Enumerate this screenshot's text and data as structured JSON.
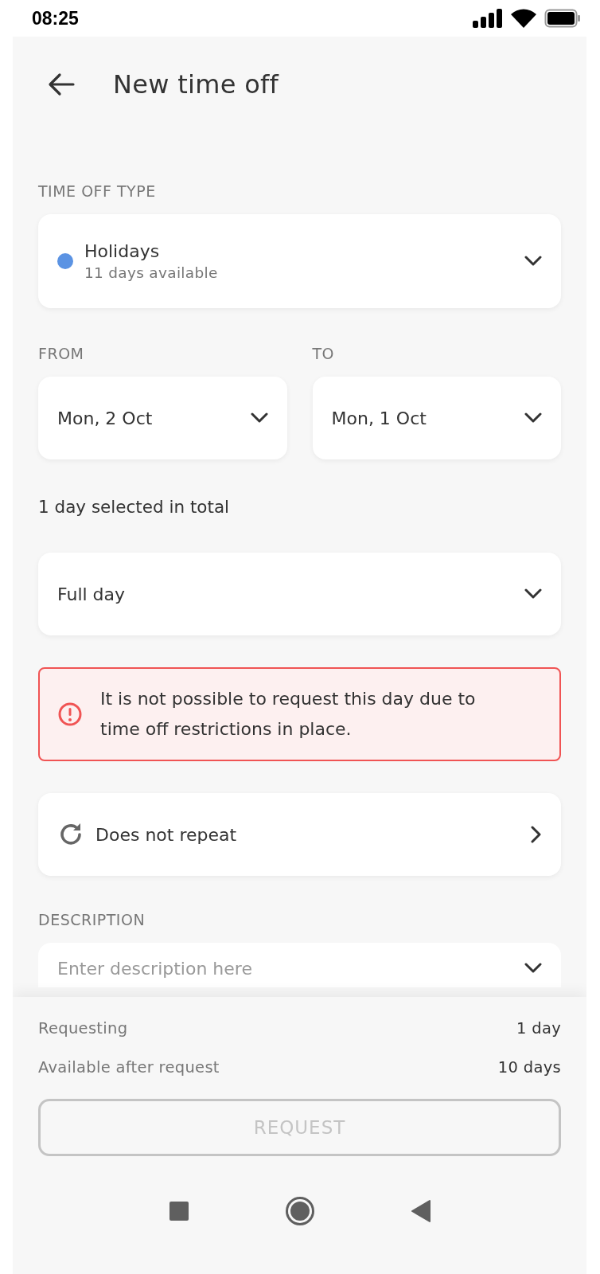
{
  "status_bar": {
    "time": "08:25"
  },
  "header": {
    "title": "New time off"
  },
  "time_off_type": {
    "label": "TIME OFF TYPE",
    "name": "Holidays",
    "color": "#5b93e3",
    "available": "11 days available"
  },
  "dates": [
    {
      "label": "FROM",
      "value": "Mon, 2 Oct"
    },
    {
      "label": "TO",
      "value": "Mon, 1 Oct"
    }
  ],
  "total": "1 day selected in total",
  "duration": {
    "value": "Full day"
  },
  "alert": {
    "message": "It is not possible to request this day due to time off restrictions in place."
  },
  "repeat": {
    "value": "Does not repeat"
  },
  "description": {
    "label": "DESCRIPTION",
    "placeholder": "Enter description here"
  },
  "summary": [
    {
      "label": "Requesting",
      "value": "1 day"
    },
    {
      "label": "Available after request",
      "value": "10 days"
    }
  ],
  "request_button": {
    "label": "REQUEST",
    "disabled": true
  }
}
